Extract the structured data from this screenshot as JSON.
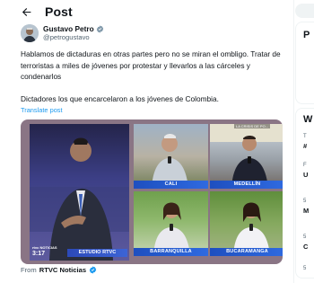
{
  "header": {
    "title": "Post"
  },
  "author": {
    "name": "Gustavo Petro",
    "handle": "@petrogustavo"
  },
  "tweet": {
    "paragraphs": [
      "Hablamos de dictaduras en otras partes pero no se miran el ombligo. Tratar de terroristas a miles de jóvenes por protestar y llevarlos a las cárceles y condenarlos",
      "Dictadores los que encarcelaron a los jóvenes de Colombia."
    ],
    "translate_label": "Translate post"
  },
  "media": {
    "studio_label": "ESTUDIO RTVC",
    "logo_line1": "rtvc NOTICIAS",
    "logo_line2": "",
    "clock": "3:17",
    "top_tag": "LA CRISIS DE PO...",
    "tiles": [
      "CALI",
      "MEDELLÍN",
      "BARRANQUILLA",
      "BUCARAMANGA"
    ]
  },
  "source": {
    "from_label": "From",
    "name": "RTVC Noticias"
  },
  "right_column": {
    "card_heading": "P",
    "trend_heading": "W",
    "trend_items": [
      {
        "small": "T",
        "bold": "#"
      },
      {
        "small": "F",
        "bold": "U"
      },
      {
        "small": "5",
        "bold": "M"
      },
      {
        "small": "5",
        "bold": "C"
      },
      {
        "small": "5",
        "bold": ""
      }
    ]
  },
  "colors": {
    "accent": "#1d9bf0",
    "text": "#0f1419",
    "muted": "#536471",
    "border": "#eff3f4",
    "label_blue": "#2f6ae0"
  }
}
